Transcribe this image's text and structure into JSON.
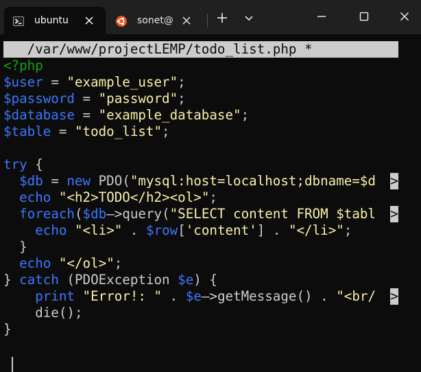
{
  "window": {
    "tabs": [
      {
        "label": "ubuntu",
        "icon": "terminal-icon",
        "active": true
      },
      {
        "label": "sonet@",
        "icon": "ubuntu-logo-icon",
        "active": false
      }
    ],
    "buttons": {
      "new_tab": "plus-icon",
      "dropdown": "chevron-down-icon",
      "minimize": "minimize-icon",
      "maximize": "maximize-icon",
      "close": "close-icon"
    }
  },
  "editor": {
    "header": "   /var/www/projectLEMP/todo_list.php *",
    "lines": [
      {
        "tokens": [
          {
            "t": "<?php",
            "c": "tag"
          }
        ]
      },
      {
        "tokens": [
          {
            "t": "$user",
            "c": "var"
          },
          {
            "t": " = ",
            "c": "txt"
          },
          {
            "t": "\"example_user\"",
            "c": "str"
          },
          {
            "t": ";",
            "c": "txt"
          }
        ]
      },
      {
        "tokens": [
          {
            "t": "$password",
            "c": "var"
          },
          {
            "t": " = ",
            "c": "txt"
          },
          {
            "t": "\"password\"",
            "c": "str"
          },
          {
            "t": ";",
            "c": "txt"
          }
        ]
      },
      {
        "tokens": [
          {
            "t": "$database",
            "c": "var"
          },
          {
            "t": " = ",
            "c": "txt"
          },
          {
            "t": "\"example_database\"",
            "c": "str"
          },
          {
            "t": ";",
            "c": "txt"
          }
        ]
      },
      {
        "tokens": [
          {
            "t": "$table",
            "c": "var"
          },
          {
            "t": " = ",
            "c": "txt"
          },
          {
            "t": "\"todo_list\"",
            "c": "str"
          },
          {
            "t": ";",
            "c": "txt"
          }
        ]
      },
      {
        "tokens": []
      },
      {
        "tokens": [
          {
            "t": "try",
            "c": "kw"
          },
          {
            "t": " {",
            "c": "txt"
          }
        ]
      },
      {
        "tokens": [
          {
            "t": "  ",
            "c": "txt"
          },
          {
            "t": "$db",
            "c": "var"
          },
          {
            "t": " = ",
            "c": "txt"
          },
          {
            "t": "new",
            "c": "kw"
          },
          {
            "t": " PDO(",
            "c": "txt"
          },
          {
            "t": "\"mysql:host=localhost;dbname=$d",
            "c": "str"
          }
        ],
        "overflow": ">"
      },
      {
        "tokens": [
          {
            "t": "  ",
            "c": "txt"
          },
          {
            "t": "echo",
            "c": "kw"
          },
          {
            "t": " ",
            "c": "txt"
          },
          {
            "t": "\"<h2>TODO</h2><ol>\"",
            "c": "str"
          },
          {
            "t": ";",
            "c": "txt"
          }
        ]
      },
      {
        "tokens": [
          {
            "t": "  ",
            "c": "txt"
          },
          {
            "t": "foreach",
            "c": "kw"
          },
          {
            "t": "(",
            "c": "txt"
          },
          {
            "t": "$db",
            "c": "var"
          },
          {
            "t": "—>query(",
            "c": "txt"
          },
          {
            "t": "\"SELECT content FROM $tabl",
            "c": "str"
          }
        ],
        "overflow": ">"
      },
      {
        "tokens": [
          {
            "t": "    ",
            "c": "txt"
          },
          {
            "t": "echo",
            "c": "kw"
          },
          {
            "t": " ",
            "c": "txt"
          },
          {
            "t": "\"<li>\"",
            "c": "str"
          },
          {
            "t": " . ",
            "c": "txt"
          },
          {
            "t": "$row",
            "c": "var"
          },
          {
            "t": "[",
            "c": "txt"
          },
          {
            "t": "'content'",
            "c": "str"
          },
          {
            "t": "] . ",
            "c": "txt"
          },
          {
            "t": "\"</li>\"",
            "c": "str"
          },
          {
            "t": ";",
            "c": "txt"
          }
        ]
      },
      {
        "tokens": [
          {
            "t": "  }",
            "c": "txt"
          }
        ]
      },
      {
        "tokens": [
          {
            "t": "  ",
            "c": "txt"
          },
          {
            "t": "echo",
            "c": "kw"
          },
          {
            "t": " ",
            "c": "txt"
          },
          {
            "t": "\"</ol>\"",
            "c": "str"
          },
          {
            "t": ";",
            "c": "txt"
          }
        ]
      },
      {
        "tokens": [
          {
            "t": "} ",
            "c": "txt"
          },
          {
            "t": "catch",
            "c": "kw"
          },
          {
            "t": " (PDOException ",
            "c": "txt"
          },
          {
            "t": "$e",
            "c": "var"
          },
          {
            "t": ") {",
            "c": "txt"
          }
        ]
      },
      {
        "tokens": [
          {
            "t": "    ",
            "c": "txt"
          },
          {
            "t": "print",
            "c": "kw"
          },
          {
            "t": " ",
            "c": "txt"
          },
          {
            "t": "\"Error!: \"",
            "c": "str"
          },
          {
            "t": " . ",
            "c": "txt"
          },
          {
            "t": "$e",
            "c": "var"
          },
          {
            "t": "—>getMessage() . ",
            "c": "txt"
          },
          {
            "t": "\"<br/",
            "c": "str"
          }
        ],
        "overflow": ">"
      },
      {
        "tokens": [
          {
            "t": "    die();",
            "c": "txt"
          }
        ]
      },
      {
        "tokens": [
          {
            "t": "}",
            "c": "txt"
          }
        ]
      }
    ]
  },
  "colors": {
    "background": "#0c0c0c",
    "tabbar": "#202020",
    "tag": "#13a10e",
    "var": "#3b78ff",
    "string": "#f9f1a5",
    "text": "#cccccc"
  }
}
